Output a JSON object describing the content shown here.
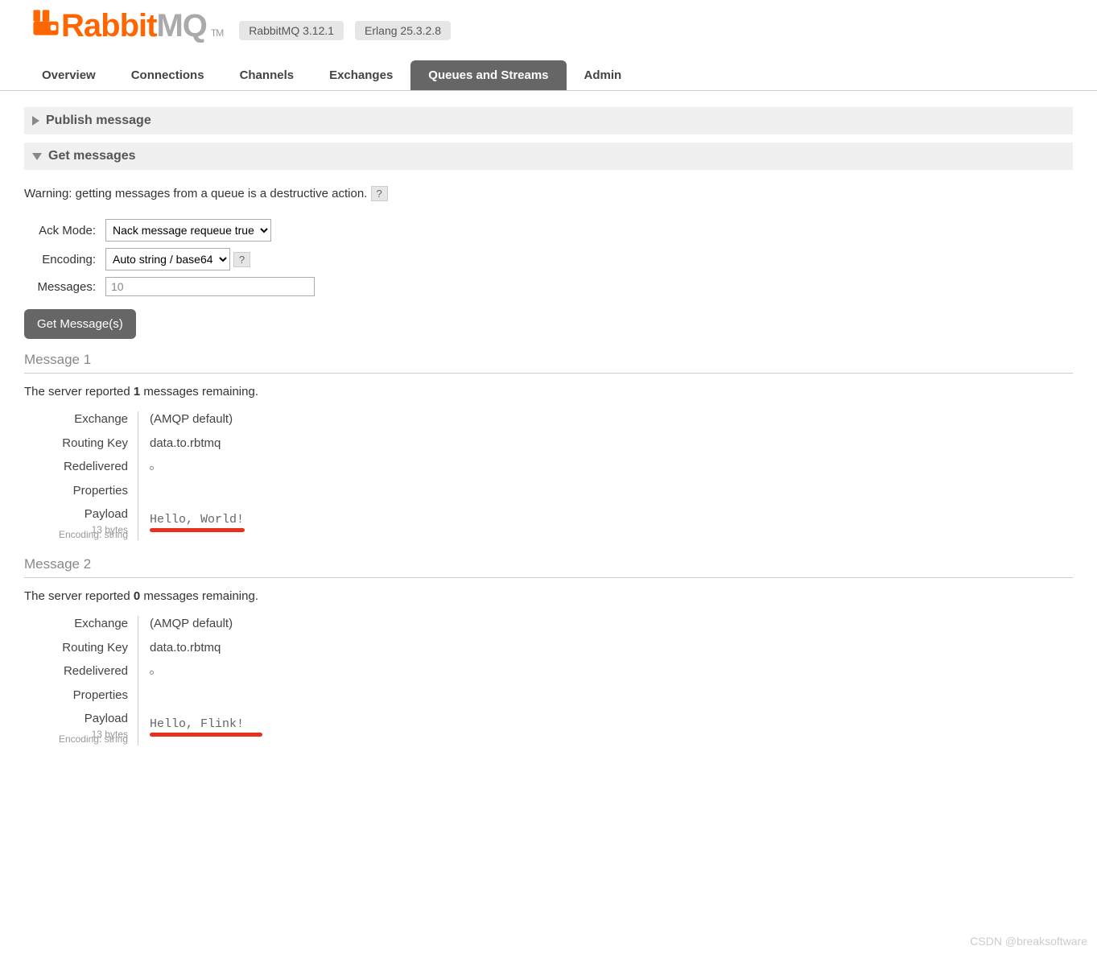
{
  "logo": {
    "rabbit": "Rabbit",
    "mq": "MQ",
    "tm": "TM"
  },
  "versions": {
    "rabbitmq": "RabbitMQ 3.12.1",
    "erlang": "Erlang 25.3.2.8"
  },
  "nav": {
    "overview": "Overview",
    "connections": "Connections",
    "channels": "Channels",
    "exchanges": "Exchanges",
    "queues": "Queues and Streams",
    "admin": "Admin"
  },
  "sections": {
    "publish": "Publish message",
    "get": "Get messages"
  },
  "warning": "Warning: getting messages from a queue is a destructive action.",
  "help": "?",
  "form": {
    "ack_label": "Ack Mode:",
    "ack_value": "Nack message requeue true",
    "encoding_label": "Encoding:",
    "encoding_value": "Auto string / base64",
    "messages_label": "Messages:",
    "messages_value": "10",
    "get_button": "Get Message(s)"
  },
  "msg1": {
    "title": "Message 1",
    "remaining_prefix": "The server reported ",
    "remaining_count": "1",
    "remaining_suffix": " messages remaining.",
    "labels": {
      "exchange": "Exchange",
      "routing_key": "Routing Key",
      "redelivered": "Redelivered",
      "properties": "Properties",
      "payload": "Payload",
      "payload_bytes": "13 bytes",
      "payload_encoding": "Encoding: string"
    },
    "values": {
      "exchange": "(AMQP default)",
      "routing_key": "data.to.rbtmq",
      "payload": "Hello, World!"
    }
  },
  "msg2": {
    "title": "Message 2",
    "remaining_prefix": "The server reported ",
    "remaining_count": "0",
    "remaining_suffix": " messages remaining.",
    "labels": {
      "exchange": "Exchange",
      "routing_key": "Routing Key",
      "redelivered": "Redelivered",
      "properties": "Properties",
      "payload": "Payload",
      "payload_bytes": "13 bytes",
      "payload_encoding": "Encoding: string"
    },
    "values": {
      "exchange": "(AMQP default)",
      "routing_key": "data.to.rbtmq",
      "payload": "Hello, Flink!"
    }
  },
  "watermark": "CSDN @breaksoftware"
}
